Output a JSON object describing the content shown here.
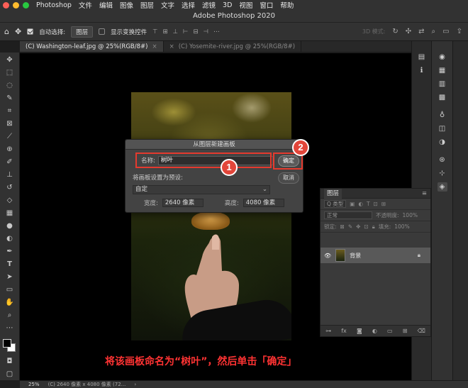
{
  "menubar": {
    "app_name": "Photoshop",
    "items": [
      "文件",
      "编辑",
      "图像",
      "图层",
      "文字",
      "选择",
      "滤镜",
      "3D",
      "视图",
      "窗口",
      "帮助"
    ],
    "traffic_colors": [
      "#ff5f57",
      "#febc2e",
      "#28c840"
    ]
  },
  "window": {
    "title": "Adobe Photoshop 2020"
  },
  "options": {
    "auto_select_label": "自动选择:",
    "auto_select_value": "图层",
    "transform_label": "显示变换控件",
    "mode_3d_label": "3D 模式:"
  },
  "tabs": [
    {
      "label": "(C) Washington-leaf.jpg @ 25%(RGB/8#)",
      "close": "×"
    },
    {
      "label": "(C) Yosemite-river.jpg @ 25%(RGB/8#)",
      "close": "×"
    }
  ],
  "dialog": {
    "title": "从图层新建画板",
    "name_label": "名称:",
    "name_value": "树叶",
    "ok_label": "确定",
    "cancel_label": "取消",
    "preset_label": "将画板设置为预设:",
    "preset_value": "自定",
    "width_label": "宽度:",
    "width_value": "2640 像素",
    "height_label": "高度:",
    "height_value": "4080 像素"
  },
  "badges": {
    "one": "1",
    "two": "2"
  },
  "layers_panel": {
    "title": "图层",
    "filter_label": "Q 类型",
    "blend_mode": "正常",
    "opacity_label": "不透明度:",
    "opacity_value": "100%",
    "lock_label": "锁定:",
    "fill_label": "填充:",
    "fill_value": "100%",
    "layer_name": "背景"
  },
  "caption": "将该画板命名为“树叶”，然后单击「确定」",
  "status": {
    "zoom": "25%",
    "info": "(C) 2640 像素 x 4080 像素 (72..."
  }
}
